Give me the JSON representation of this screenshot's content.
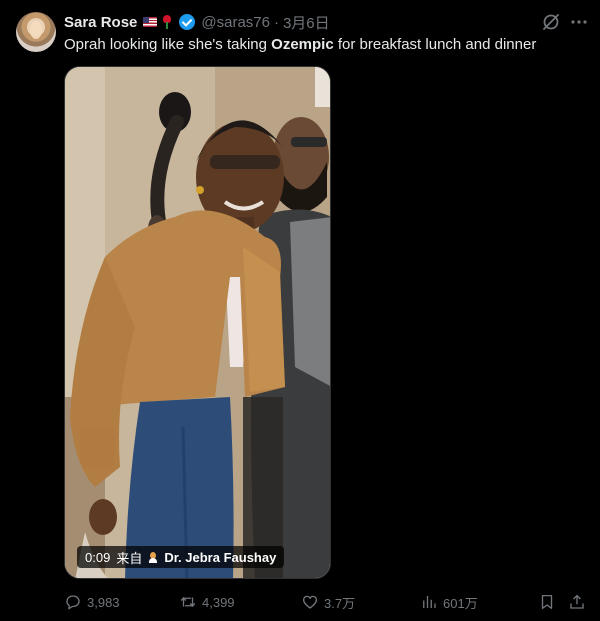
{
  "tweet": {
    "author": {
      "name": "Sara Rose",
      "handle": "@saras76",
      "separator": "·",
      "date": "3月6日"
    },
    "text": {
      "before": "Oprah looking like she's taking ",
      "bold": "Ozempic",
      "after": " for breakfast lunch and dinner"
    },
    "media": {
      "duration": "0:09",
      "source_prefix": "来自",
      "source_name": "Dr. Jebra Faushay"
    },
    "actions": {
      "replies": "3,983",
      "reposts": "4,399",
      "likes": "3.7万",
      "views": "601万"
    },
    "icons": {
      "verified": "verified-badge-icon",
      "grok": "grok-icon",
      "more": "more-icon",
      "reply": "reply-icon",
      "repost": "repost-icon",
      "like": "heart-icon",
      "views": "views-icon",
      "bookmark": "bookmark-icon",
      "share": "share-icon"
    },
    "colors": {
      "background": "#000000",
      "text": "#e7e9ea",
      "muted": "#71767b",
      "verified": "#1d9bf0"
    }
  }
}
